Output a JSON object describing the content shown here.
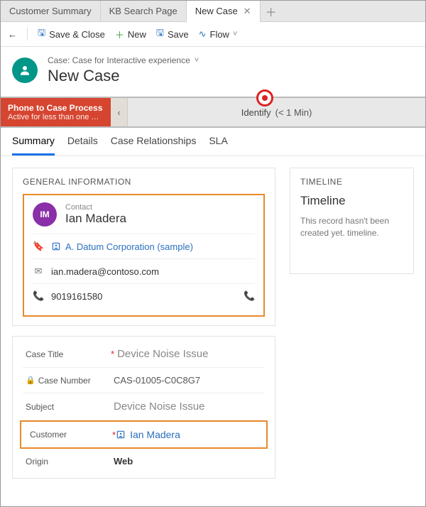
{
  "tabs": {
    "items": [
      "Customer Summary",
      "KB Search Page",
      "New Case"
    ],
    "active": 2
  },
  "commands": {
    "save_close": "Save & Close",
    "new": "New",
    "save": "Save",
    "flow": "Flow"
  },
  "record": {
    "type_line": "Case: Case for Interactive experience",
    "title": "New Case"
  },
  "process": {
    "name": "Phone to Case Process",
    "status": "Active for less than one mi…",
    "stage": "Identify",
    "stage_time": "(< 1 Min)"
  },
  "sub_tabs": [
    "Summary",
    "Details",
    "Case Relationships",
    "SLA"
  ],
  "general_info": {
    "section_title": "GENERAL INFORMATION",
    "contact_label": "Contact",
    "contact_name": "Ian Madera",
    "avatar_initials": "IM",
    "company": "A. Datum Corporation (sample)",
    "email": "ian.madera@contoso.com",
    "phone": "9019161580"
  },
  "case_fields": {
    "case_title_label": "Case Title",
    "case_title_value": "Device Noise Issue",
    "case_number_label": "Case Number",
    "case_number_value": "CAS-01005-C0C8G7",
    "subject_label": "Subject",
    "subject_value": "Device Noise Issue",
    "customer_label": "Customer",
    "customer_value": "Ian Madera",
    "origin_label": "Origin",
    "origin_value": "Web"
  },
  "timeline": {
    "section_title": "TIMELINE",
    "header": "Timeline",
    "message": "This record hasn't been created yet. timeline."
  }
}
